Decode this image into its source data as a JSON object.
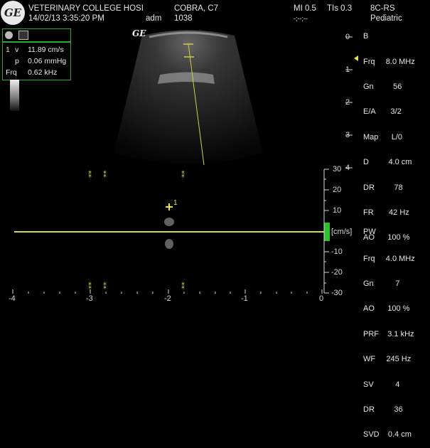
{
  "header": {
    "logo_text": "GE",
    "institution": "VETERINARY COLLEGE HOSI",
    "datetime": "14/02/13 3:35:20 PM",
    "operator": "adm",
    "patient_name": "COBRA, C7",
    "patient_id": "1038",
    "mi": "MI 0.5",
    "tis": "TIs 0.3",
    "tis_sub": "-;--;--",
    "probe": "8C-RS",
    "preset": "Pediatric"
  },
  "b_mode_params": {
    "mode": "B",
    "lines": [
      "Frq     8.0 MHz",
      "Gn         56",
      "E/A       3/2",
      "Map      L/0",
      "D         4.0 cm",
      "DR         78",
      "FR       42 Hz",
      "AO      100 %"
    ]
  },
  "pw_params": {
    "mode": "PW",
    "lines": [
      "Frq     4.0 MHz",
      "Gn          7",
      "AO      100 %",
      "PRF    3.1 kHz",
      "WF     245 Hz",
      "SV          4",
      "DR         36",
      "SVD    0.4 cm"
    ]
  },
  "measurement": {
    "index": "1",
    "v_label": "v",
    "v_value": "11.89 cm/s",
    "p_label": "p",
    "p_value": "0.06 mmHg",
    "frq_label": "Frq",
    "frq_value": "0.62 kHz"
  },
  "image_logo": "GE",
  "depth_scale": [
    "0",
    "1",
    "2",
    "3",
    "4"
  ],
  "velocity_scale": {
    "unit": "[cm/s]",
    "ticks": [
      "30",
      "20",
      "10",
      "-10",
      "-20",
      "-30"
    ]
  },
  "time_axis": [
    "-4",
    "-3",
    "-2",
    "-1",
    "0"
  ],
  "cursor_marker": "+1",
  "colors": {
    "accent_green": "#2fa82f",
    "cursor_yellow": "#d6d64a",
    "text": "#e6e6e6"
  }
}
